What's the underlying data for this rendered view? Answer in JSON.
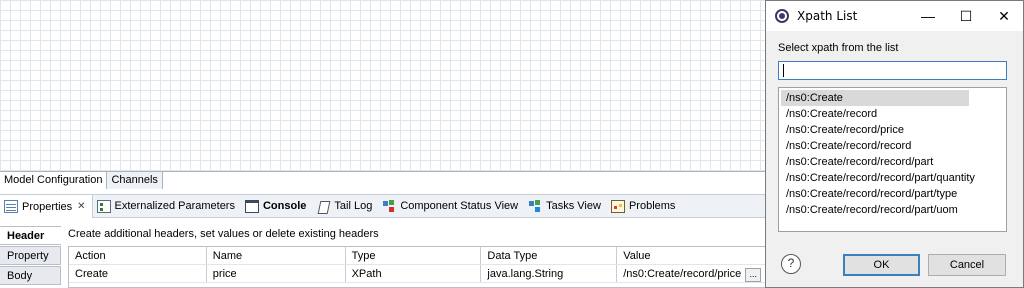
{
  "model_tabs": [
    {
      "label": "Model Configuration"
    },
    {
      "label": "Channels"
    }
  ],
  "views": [
    {
      "label": "Properties",
      "icon": "properties-icon",
      "closable": true,
      "close_glyph": "✕"
    },
    {
      "label": "Externalized Parameters",
      "icon": "externalized-parameters-icon"
    },
    {
      "label": "Console",
      "icon": "console-icon"
    },
    {
      "label": "Tail Log",
      "icon": "tail-log-icon"
    },
    {
      "label": "Component Status View",
      "icon": "component-status-icon"
    },
    {
      "label": "Tasks View",
      "icon": "tasks-icon"
    },
    {
      "label": "Problems",
      "icon": "problems-icon"
    }
  ],
  "properties": {
    "side_tabs": [
      "Header",
      "Property",
      "Body"
    ],
    "description": "Create additional headers, set values or delete existing headers",
    "columns": [
      "Action",
      "Name",
      "Type",
      "Data Type",
      "Value"
    ],
    "rows": [
      {
        "action": "Create",
        "name": "price",
        "type": "XPath",
        "data_type": "java.lang.String",
        "value": "/ns0:Create/record/price",
        "button": "..."
      }
    ],
    "partial_column": "I"
  },
  "dialog": {
    "title": "Xpath List",
    "window_buttons": {
      "minimize": "—",
      "maximize": "☐",
      "close": "✕"
    },
    "prompt": "Select xpath from the list",
    "search_value": "",
    "items": [
      "/ns0:Create",
      "/ns0:Create/record",
      "/ns0:Create/record/price",
      "/ns0:Create/record/record",
      "/ns0:Create/record/record/part",
      "/ns0:Create/record/record/part/quantity",
      "/ns0:Create/record/record/part/type",
      "/ns0:Create/record/record/part/uom"
    ],
    "selected_index": 0,
    "help_label": "?",
    "ok_label": "OK",
    "cancel_label": "Cancel"
  }
}
